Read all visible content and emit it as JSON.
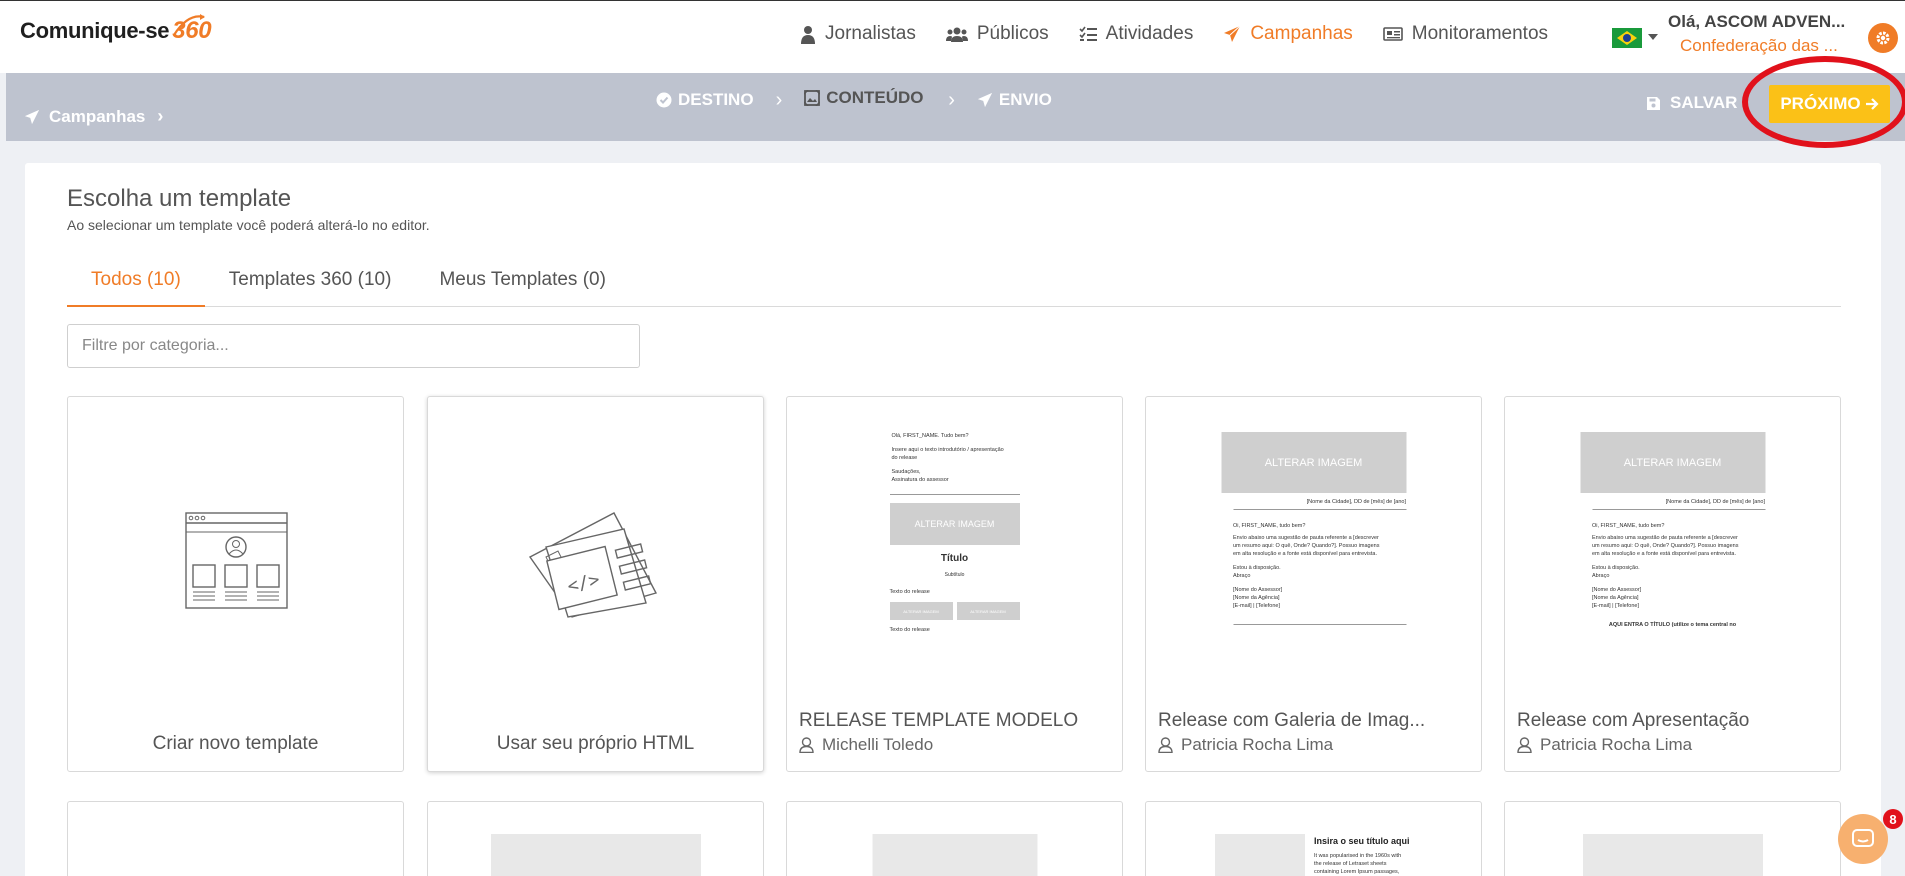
{
  "brand": {
    "name": "Comunique-se",
    "number": "360"
  },
  "nav": {
    "items": [
      {
        "label": "Jornalistas",
        "icon": "journalist-icon"
      },
      {
        "label": "Públicos",
        "icon": "group-icon"
      },
      {
        "label": "Atividades",
        "icon": "checklist-icon"
      },
      {
        "label": "Campanhas",
        "icon": "paper-plane-icon",
        "active": true
      },
      {
        "label": "Monitoramentos",
        "icon": "newspaper-icon"
      }
    ]
  },
  "user": {
    "greeting": "Olá, ASCOM ADVEN...",
    "org": "Confederação das ..."
  },
  "stepbar": {
    "breadcrumb": "Campanhas",
    "steps": [
      {
        "label": "DESTINO",
        "icon": "check-circle-icon"
      },
      {
        "label": "CONTEÚDO",
        "icon": "image-frame-icon",
        "active": true
      },
      {
        "label": "ENVIO",
        "icon": "paper-plane-icon"
      }
    ],
    "save_label": "SALVAR",
    "next_label": "PRÓXIMO"
  },
  "page": {
    "title": "Escolha um template",
    "subtitle": "Ao selecionar um template você poderá alterá-lo no editor.",
    "tabs": [
      "Todos (10)",
      "Templates 360 (10)",
      "Meus Templates (0)"
    ],
    "filter_placeholder": "Filtre por categoria..."
  },
  "cards": {
    "new_template": "Criar novo template",
    "own_html": "Usar seu próprio HTML",
    "templates": [
      {
        "name": "RELEASE TEMPLATE MODELO",
        "author": "Michelli Toledo"
      },
      {
        "name": "Release com Galeria de Imag...",
        "author": "Patricia Rocha Lima"
      },
      {
        "name": "Release com Apresentação",
        "author": "Patricia Rocha Lima"
      }
    ]
  },
  "thumbs": {
    "modelo": {
      "greeting": "Olá, FIRST_NAME. Tudo bem?",
      "intro1": "Insere aqui o texto introdutório / apresentação",
      "intro2": "do release",
      "saud": "Saudações,",
      "assin": "Assinatura do assessor",
      "img": "ALTERAR IMAGEM",
      "title": "Título",
      "subtitle": "Subtítulo",
      "text": "Texto do release",
      "btn1": "ALTERAR IMAGEM",
      "btn2": "ALTERAR IMAGEM",
      "text2": "Texto do release"
    },
    "galeria": {
      "img": "ALTERAR IMAGEM",
      "city": "[Nome da Cidade], DD de [mês] de [ano]",
      "greet": "Oi, FIRST_NAME, tudo bem?",
      "p1": "Envio abaixo uma sugestão de pauta referente a [descrever",
      "p2": "um resumo aqui: O quê, Onde? Quando?]. Possuo imagens",
      "p3": "em alta resolução e a fonte está disponível para entrevista.",
      "p4": "Estou à disposição.",
      "p5": "Abraço",
      "p6": "[Nome do Assessor]",
      "p7": "[Nome da Agência]",
      "p8": "[E-mail] | [Telefone]"
    },
    "apresentacao": {
      "img": "ALTERAR IMAGEM",
      "city": "[Nome da Cidade], DD de [mês] de [ano]",
      "greet": "Oi, FIRST_NAME, tudo bem?",
      "p1": "Envio abaixo uma sugestão de pauta referente a [descrever",
      "p2": "um resumo aqui: O quê, Onde? Quando?]. Possuo imagens",
      "p3": "em alta resolução e a fonte está disponível para entrevista.",
      "p4": "Estou à disposição.",
      "p5": "Abraço",
      "p6": "[Nome do Assessor]",
      "p7": "[Nome da Agência]",
      "p8": "[E-mail] | [Telefone]",
      "heading": "AQUI ENTRA O TÍTULO (utilize o tema central no"
    },
    "row2_title": "Insira o seu título aqui",
    "row2_p1": "It was popularised in the 1960s with",
    "row2_p2": "the release of Letraset sheets",
    "row2_p3": "containing Lorem Ipsum passages,"
  },
  "chat": {
    "badge": "8"
  },
  "colors": {
    "accent": "#f07c27",
    "next_button": "#fbc117",
    "stepbar": "#bec3cf",
    "highlight_ring": "#e1111b"
  }
}
